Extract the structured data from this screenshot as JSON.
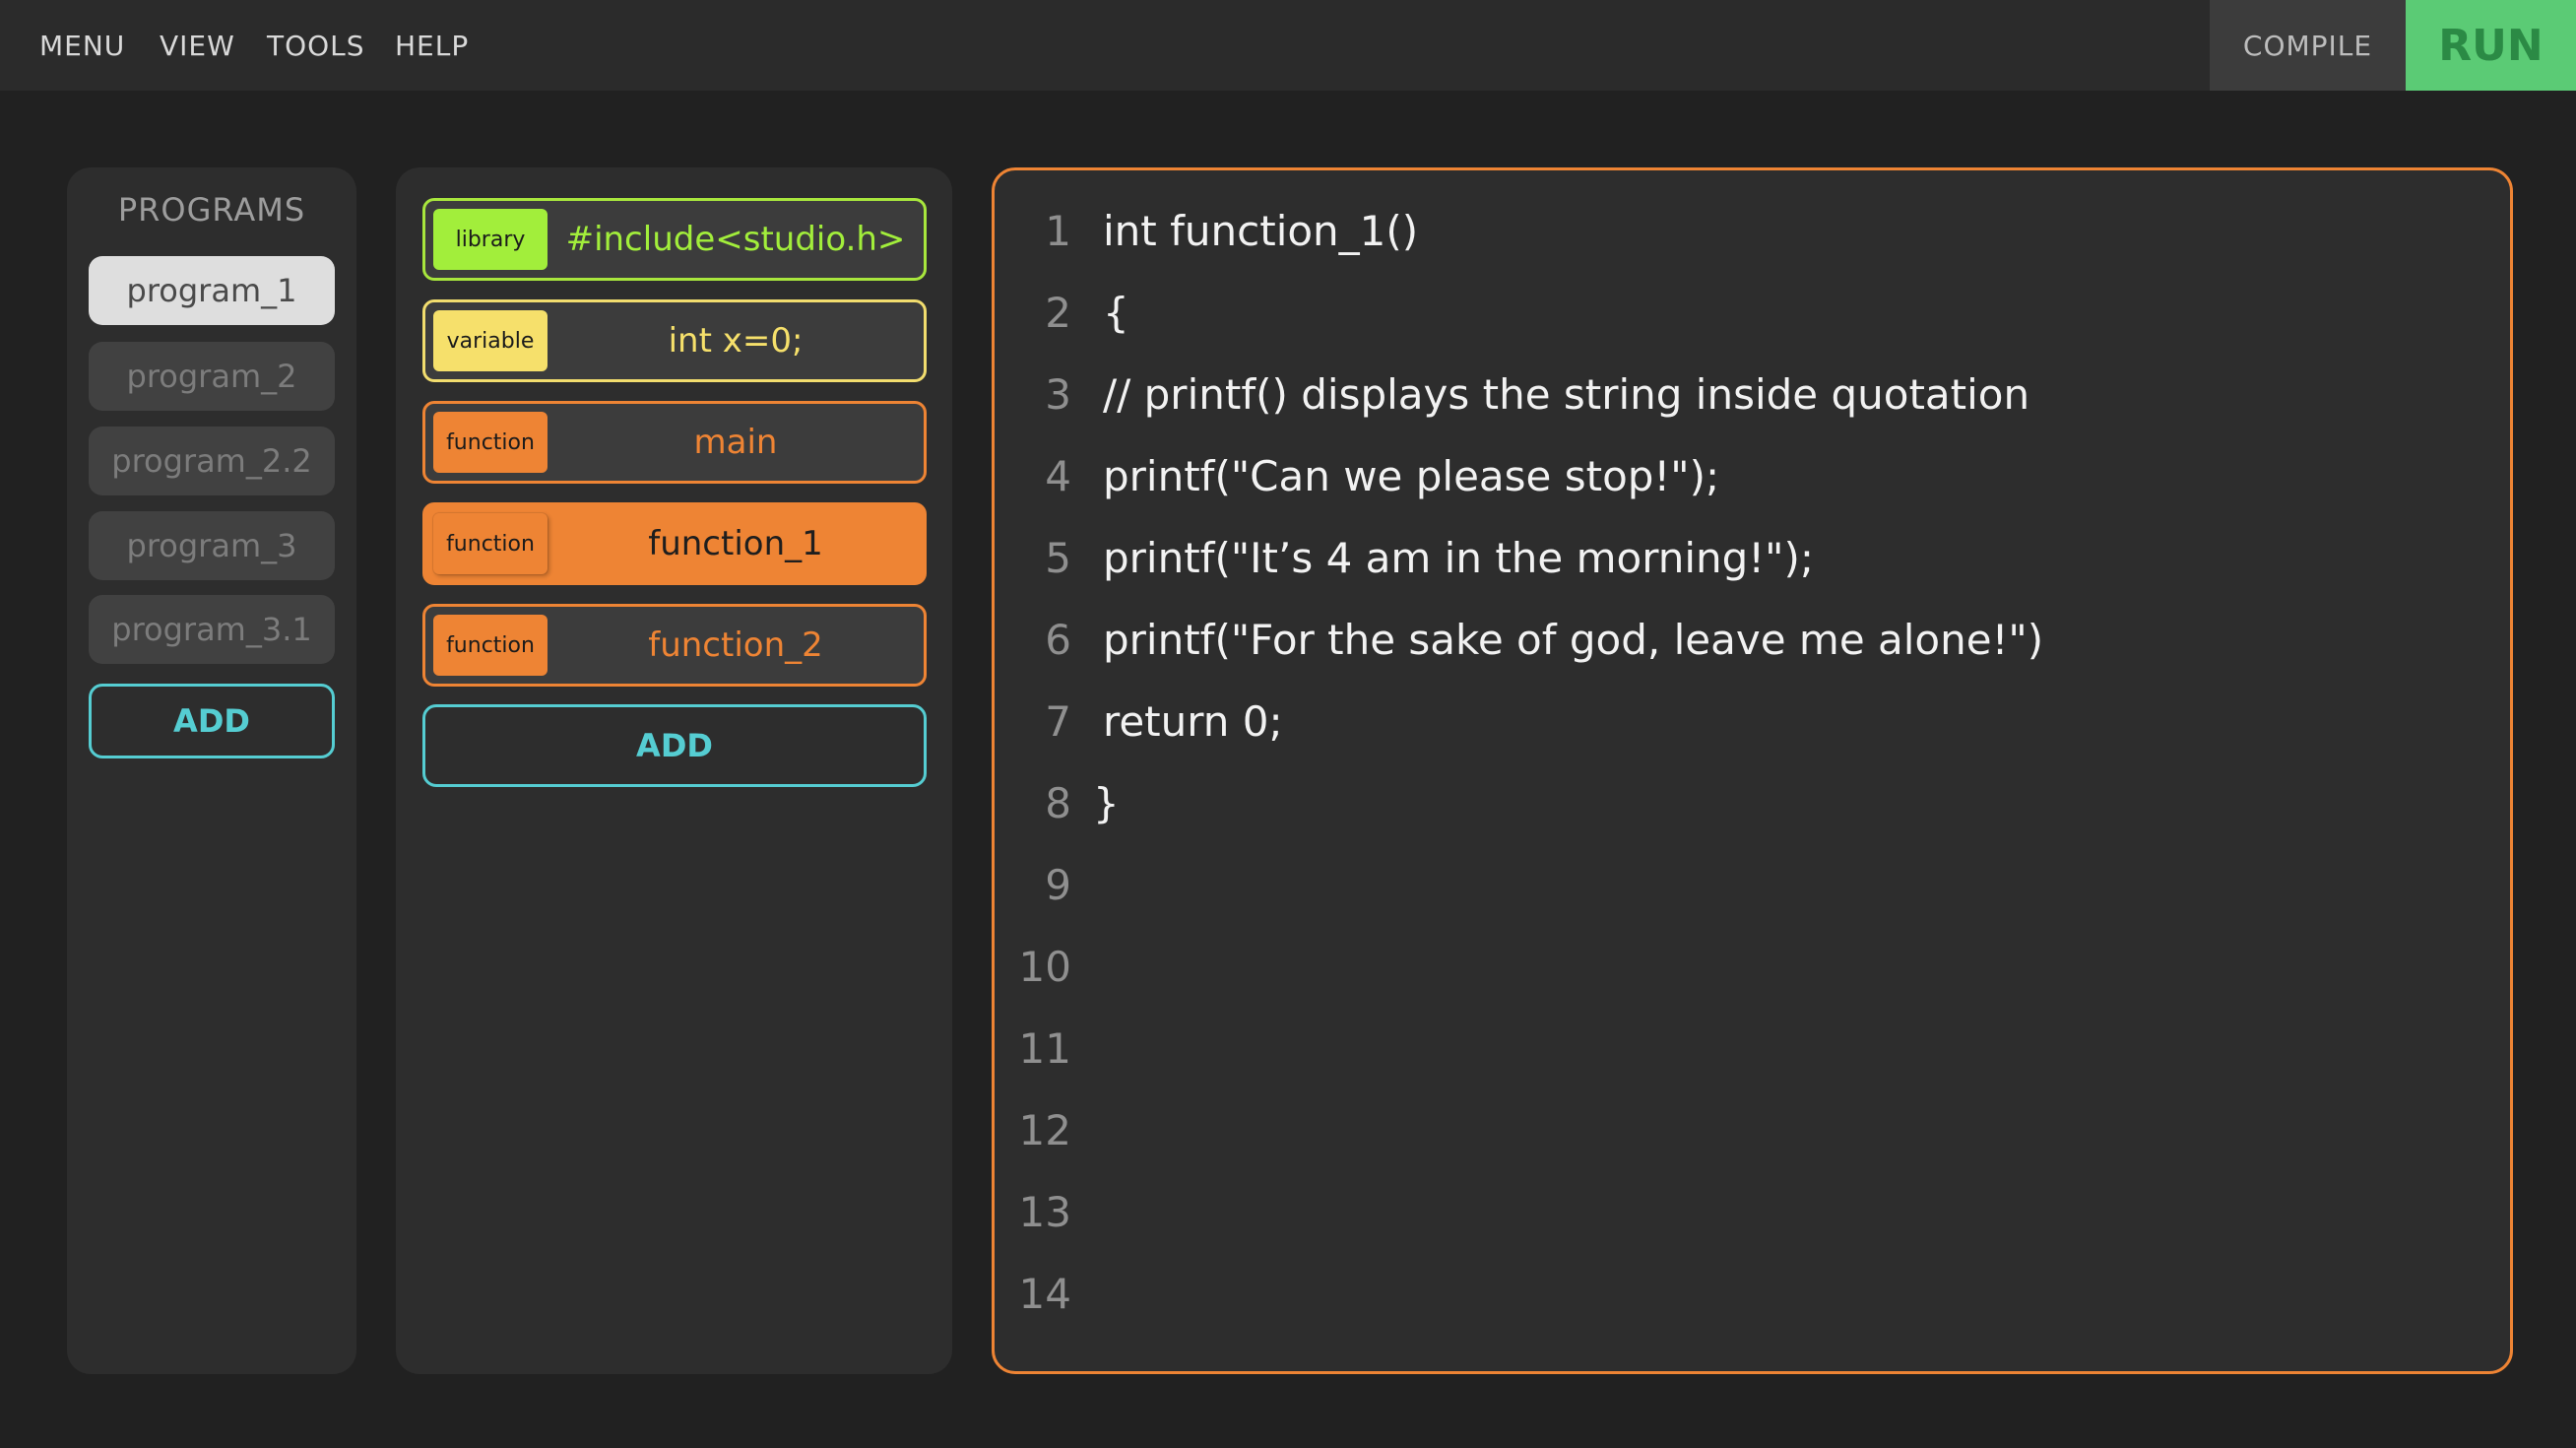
{
  "menubar": {
    "items": [
      "MENU",
      "VIEW",
      "TOOLS",
      "HELP"
    ]
  },
  "toolbar": {
    "compile_label": "COMPILE",
    "run_label": "RUN"
  },
  "programs": {
    "title": "PROGRAMS",
    "items": [
      {
        "label": "program_1",
        "active": true
      },
      {
        "label": "program_2",
        "active": false
      },
      {
        "label": "program_2.2",
        "active": false
      },
      {
        "label": "program_3",
        "active": false
      },
      {
        "label": "program_3.1",
        "active": false
      }
    ],
    "add_label": "ADD"
  },
  "blocks": {
    "items": [
      {
        "kind": "library",
        "tag": "library",
        "text": "#include<studio.h>",
        "selected": false
      },
      {
        "kind": "variable",
        "tag": "variable",
        "text": "int x=0;",
        "selected": false
      },
      {
        "kind": "function",
        "tag": "function",
        "text": "main",
        "selected": false
      },
      {
        "kind": "function",
        "tag": "function",
        "text": "function_1",
        "selected": true
      },
      {
        "kind": "function",
        "tag": "function",
        "text": "function_2",
        "selected": false
      }
    ],
    "add_label": "ADD"
  },
  "editor": {
    "lines": [
      {
        "num": "1",
        "code": "int function_1()"
      },
      {
        "num": "2",
        "code": "{"
      },
      {
        "num": "3",
        "code": "// printf() displays the string inside quotation"
      },
      {
        "num": "4",
        "code": "printf(\"Can we please stop!\");"
      },
      {
        "num": "5",
        "code": "printf(\"It’s 4 am in the morning!\");"
      },
      {
        "num": "6",
        "code": "printf(\"For the sake of god, leave me alone!\")"
      },
      {
        "num": "7",
        "code": "return 0;"
      },
      {
        "num": "8",
        "code": "}"
      },
      {
        "num": "9",
        "code": ""
      },
      {
        "num": "10",
        "code": ""
      },
      {
        "num": "11",
        "code": ""
      },
      {
        "num": "12",
        "code": ""
      },
      {
        "num": "13",
        "code": ""
      },
      {
        "num": "14",
        "code": ""
      }
    ]
  },
  "colors": {
    "accent_orange": "#ee8434",
    "library_green": "#a2ee3b",
    "variable_yellow": "#f6e06b",
    "add_cyan": "#55cdd2",
    "run_green": "#5bcb75"
  }
}
